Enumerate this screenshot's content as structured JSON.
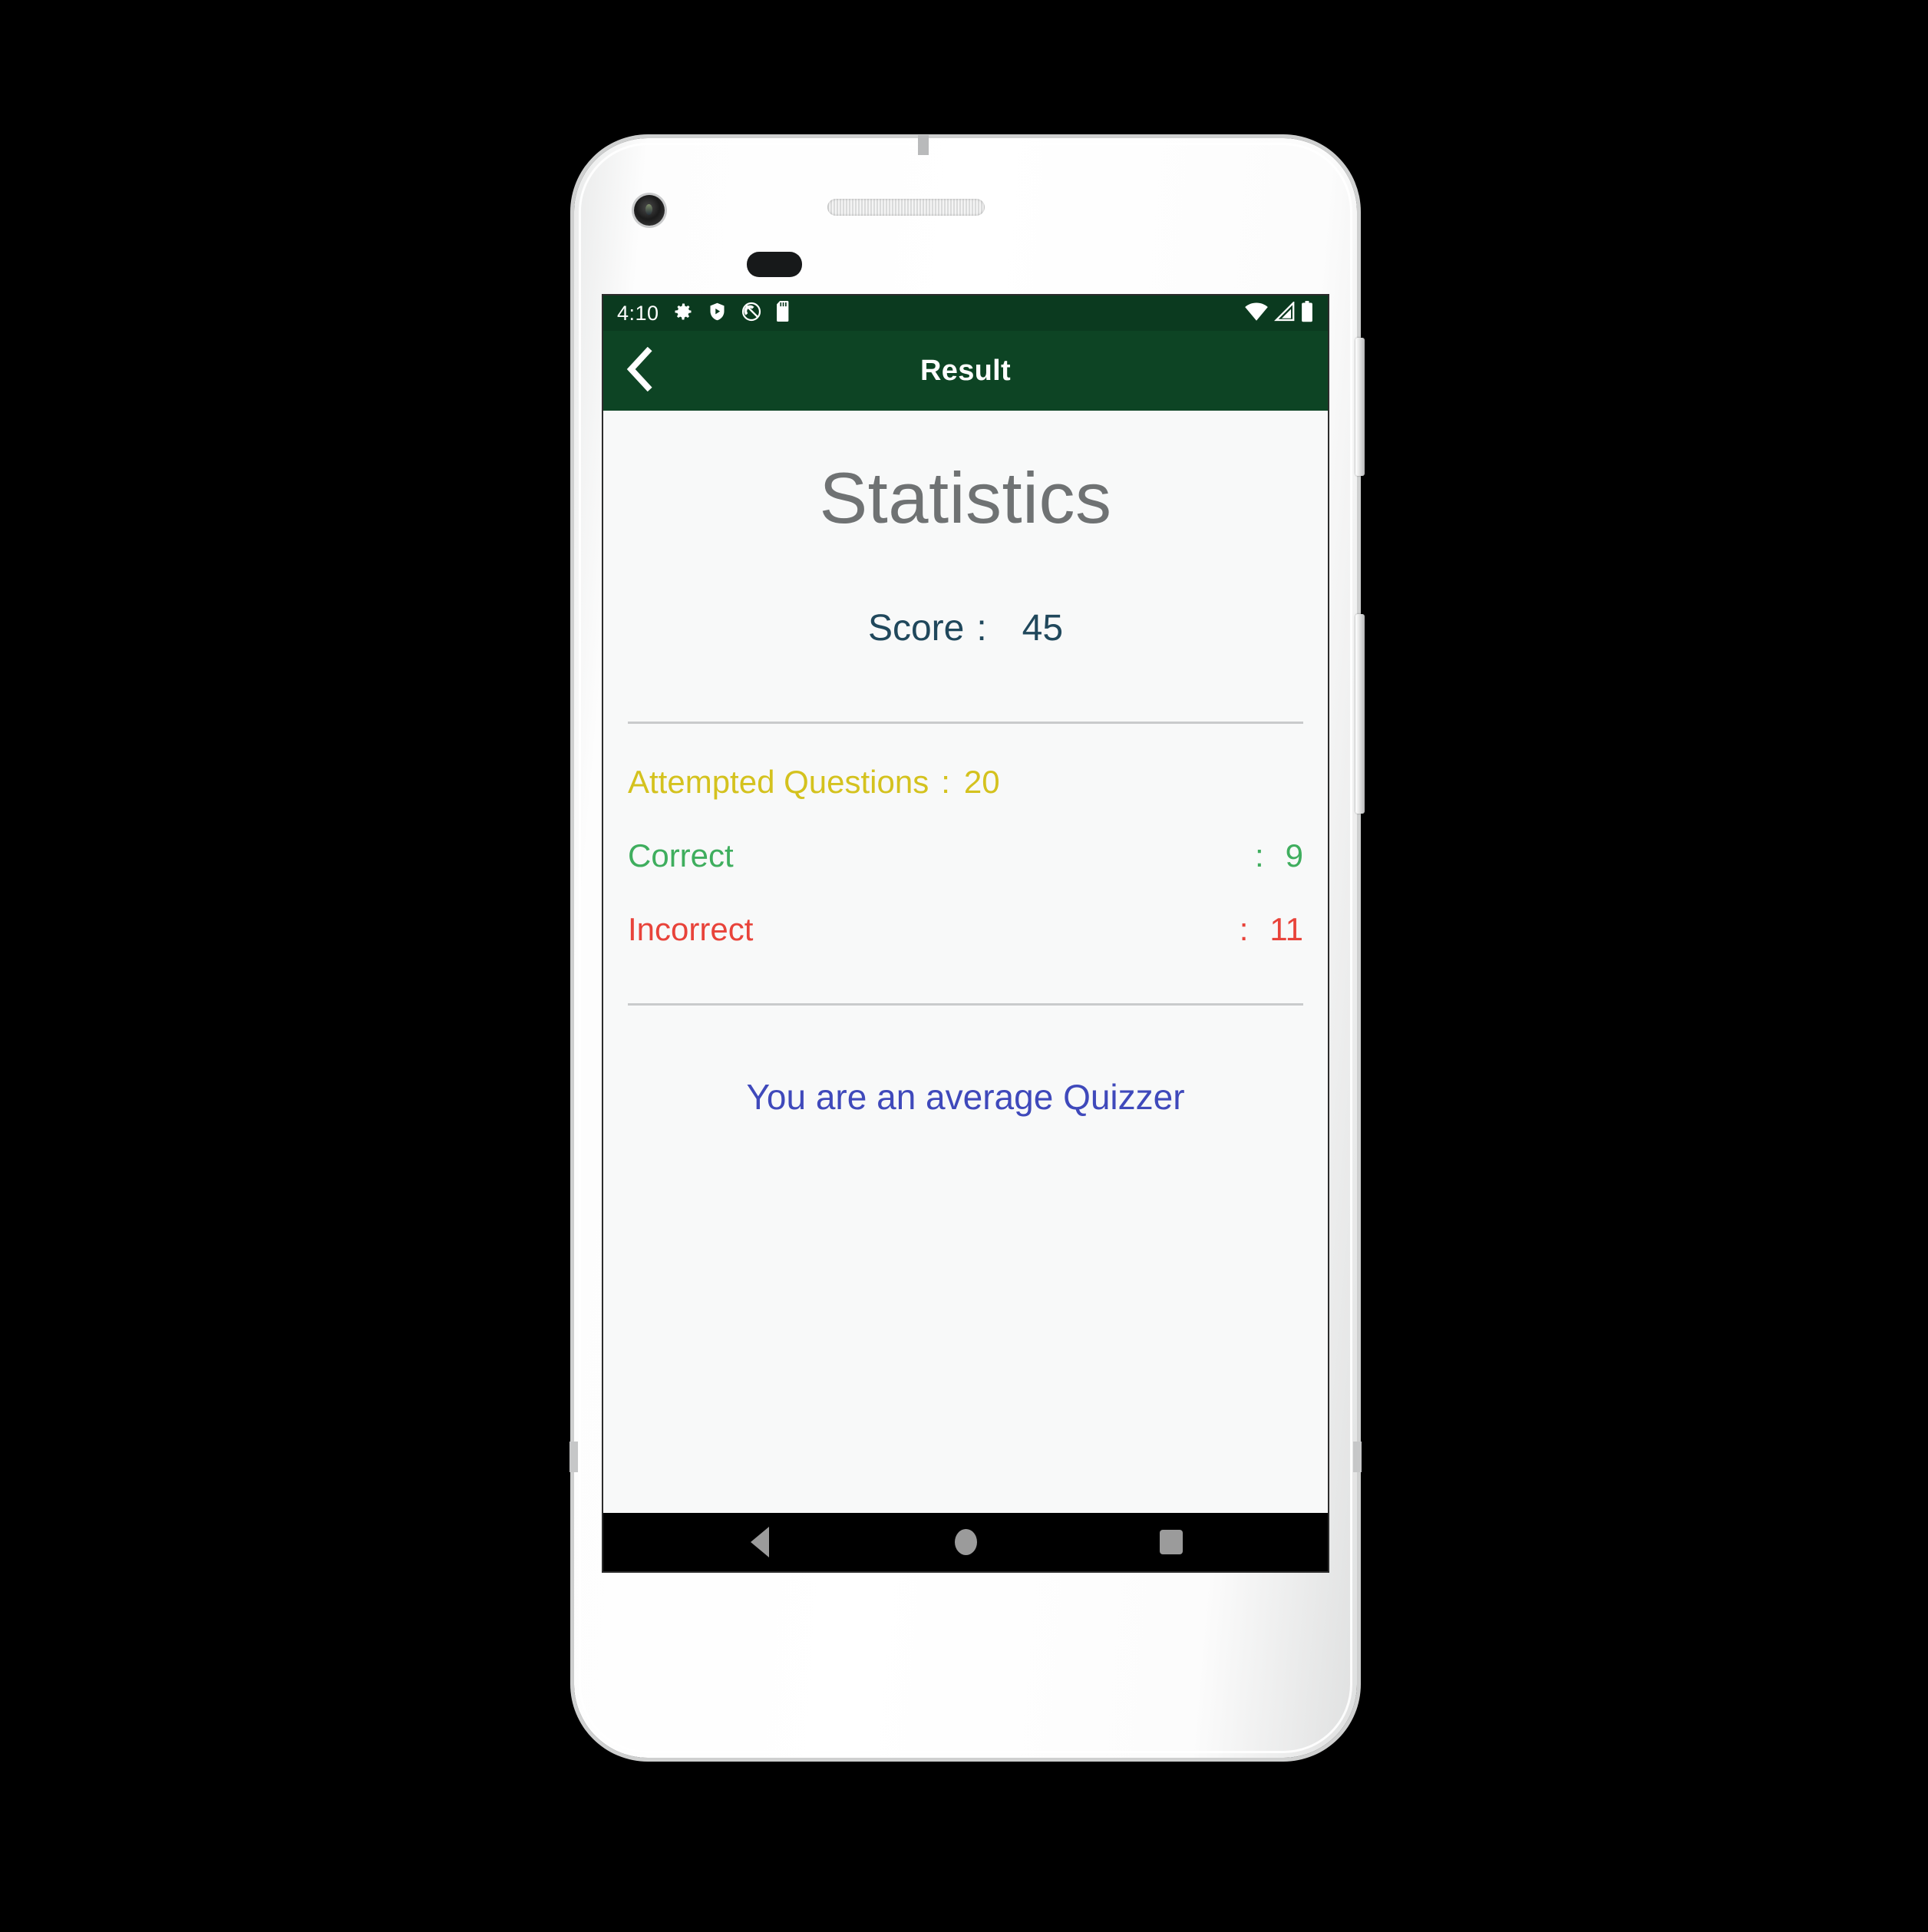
{
  "device": {
    "label": "android-phone-mockup",
    "icons": {
      "front_camera": "camera-icon",
      "earpiece": "speaker-grille-icon",
      "sensor": "proximity-sensor-icon",
      "power_button": "power-button",
      "volume_button": "volume-rocker-button"
    }
  },
  "colors": {
    "status_bar_bg": "#0b3a1f",
    "app_bar_bg": "#0d4424",
    "content_bg": "#f8f9f9",
    "nav_bar_bg": "#000000",
    "heading": "#6f7273",
    "score": "#20485c",
    "attempted": "#d4c21e",
    "correct": "#3fae5e",
    "incorrect": "#e8433a",
    "verdict": "#3f49bb",
    "divider": "#c9cbcc"
  },
  "status_bar": {
    "time": "4:10",
    "left_icons": [
      "gear-icon",
      "shield-play-icon",
      "do-not-disturb-icon",
      "sd-card-icon"
    ],
    "right_icons": [
      "wifi-icon",
      "signal-icon",
      "battery-icon"
    ]
  },
  "app_bar": {
    "title": "Result",
    "back_icon": "chevron-left-icon"
  },
  "main": {
    "heading": "Statistics",
    "score": {
      "label": "Score",
      "colon": ":",
      "value": "45"
    },
    "stats": [
      {
        "label": "Attempted Questions",
        "colon": ":",
        "value": "20",
        "color": "#d4c21e",
        "inline": true
      },
      {
        "label": "Correct",
        "colon": ":",
        "value": "9",
        "color": "#3fae5e",
        "inline": false
      },
      {
        "label": "Incorrect",
        "colon": ":",
        "value": "11",
        "color": "#e8433a",
        "inline": false
      }
    ],
    "verdict": "You are an average Quizzer"
  },
  "nav_bar": {
    "back": "back-nav-icon",
    "home": "home-nav-icon",
    "recents": "recents-nav-icon"
  }
}
